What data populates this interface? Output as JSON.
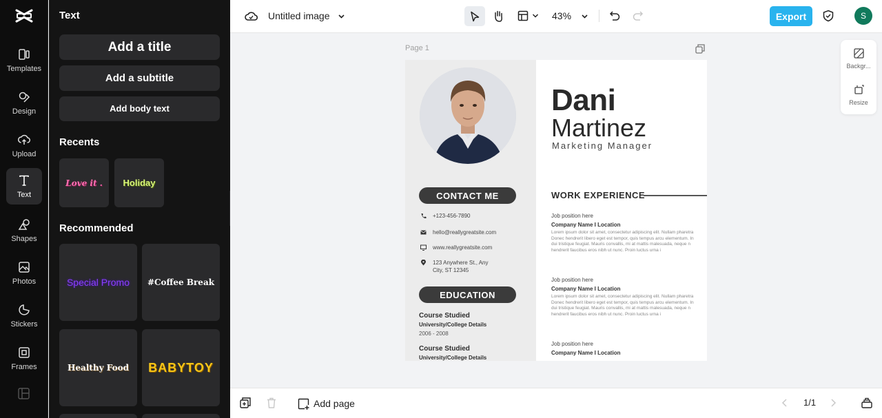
{
  "rail": {
    "items": [
      {
        "label": "Templates",
        "icon": "templates-icon"
      },
      {
        "label": "Design",
        "icon": "design-icon"
      },
      {
        "label": "Upload",
        "icon": "upload-icon"
      },
      {
        "label": "Text",
        "icon": "text-icon",
        "active": true
      },
      {
        "label": "Shapes",
        "icon": "shapes-icon"
      },
      {
        "label": "Photos",
        "icon": "photos-icon"
      },
      {
        "label": "Stickers",
        "icon": "stickers-icon"
      },
      {
        "label": "Frames",
        "icon": "frames-icon"
      }
    ]
  },
  "panel": {
    "title": "Text",
    "add_title": "Add a title",
    "add_subtitle": "Add a subtitle",
    "add_body": "Add body text",
    "recents_heading": "Recents",
    "recents": [
      {
        "text": "Love it .",
        "color": "#ff6fb1"
      },
      {
        "text": "Holiday",
        "color": "#d9f57a"
      }
    ],
    "recommended_heading": "Recommended",
    "recommended": [
      {
        "text": "Special Promo",
        "color": "#8a3ffc"
      },
      {
        "text": "#Coffee Break",
        "color": "#ffffff"
      },
      {
        "text": "Healthy Food",
        "color": "#ffffff"
      },
      {
        "text": "BABYTOY",
        "color": "#f5c518"
      }
    ]
  },
  "topbar": {
    "doc_title": "Untitled image",
    "zoom": "43%",
    "export_label": "Export",
    "avatar_letter": "S"
  },
  "canvas": {
    "page_label": "Page 1",
    "side_tools": [
      {
        "label": "Backgr...",
        "icon": "background-icon"
      },
      {
        "label": "Resize",
        "icon": "resize-icon"
      }
    ]
  },
  "resume": {
    "first_name": "Dani",
    "last_name": "Martinez",
    "role": "Marketing Manager",
    "contact_heading": "CONTACT ME",
    "contacts": [
      {
        "icon": "phone-icon",
        "text": "+123-456-7890"
      },
      {
        "icon": "mail-icon",
        "text": "hello@reallygreatsite.com"
      },
      {
        "icon": "monitor-icon",
        "text": "www.reallygreatsite.com"
      },
      {
        "icon": "location-icon",
        "text": "123 Anywhere St., Any",
        "text2": "City, ST 12345"
      }
    ],
    "education_heading": "EDUCATION",
    "education": [
      {
        "course": "Course Studied",
        "school": "University/College Details",
        "years": "2006 - 2008"
      },
      {
        "course": "Course Studied",
        "school": "University/College Details",
        "years": ""
      }
    ],
    "work_heading": "WORK EXPERIENCE",
    "jobs": [
      {
        "position": "Job position here",
        "company": "Company Name I Location",
        "lines": [
          "Lorem ipsum dolor sit amet, consectetur adipiscing elit. Nullam pharetra",
          "Donec hendrerit libero eget est tempor, quis tempus arcu elementum. In",
          "dui tristique feugiat. Mauris convallis, mi at mattis malesuada, neque n",
          "hendrerit faucibus eros nibh ut nunc. Proin luctus urna i"
        ]
      },
      {
        "position": "Job position here",
        "company": "Company Name I Location",
        "lines": [
          "Lorem ipsum dolor sit amet, consectetur adipiscing elit. Nullam pharetra",
          "Donec hendrerit libero eget est tempor, quis tempus arcu elementum. In",
          "dui tristique feugiat. Mauris convallis, mi at mattis malesuada, neque n",
          "hendrerit faucibus eros nibh ut nunc. Proin luctus urna i"
        ]
      },
      {
        "position": "Job position here",
        "company": "Company Name I Location",
        "lines": []
      }
    ]
  },
  "bottombar": {
    "add_page": "Add page",
    "page_count": "1/1"
  },
  "colors": {
    "accent": "#29b3ee",
    "avatar": "#117a5c",
    "pill": "#3b3b3b"
  }
}
